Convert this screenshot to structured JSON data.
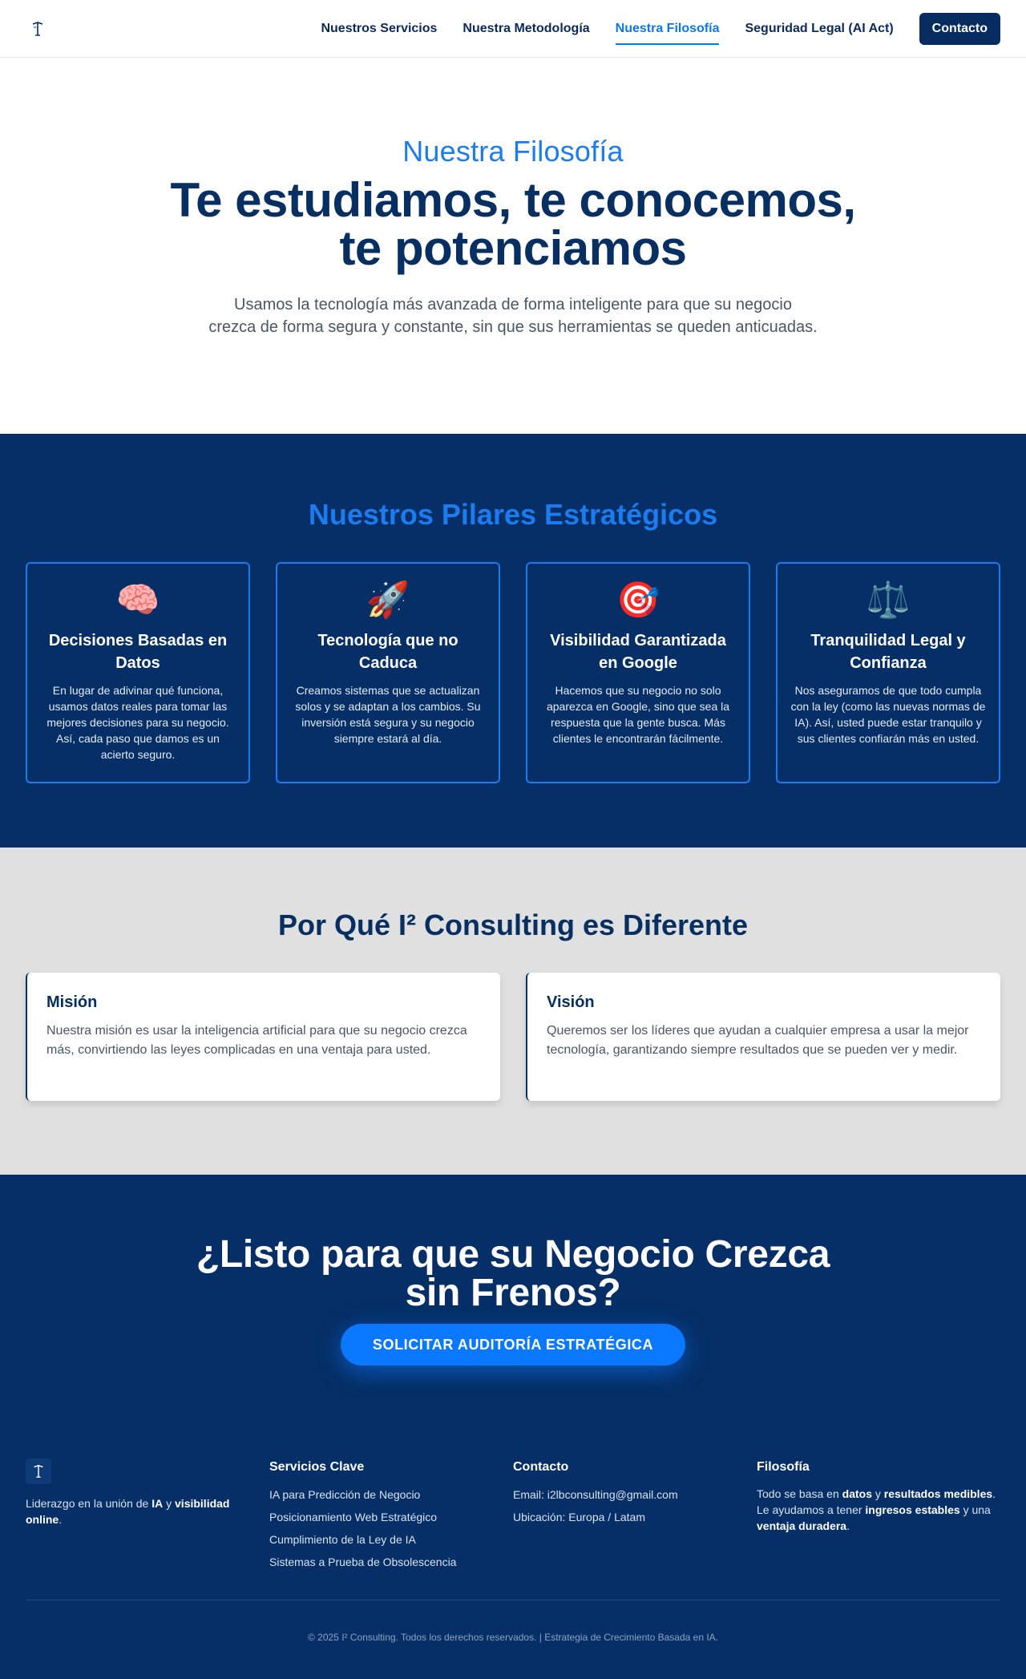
{
  "header": {
    "nav": [
      {
        "label": "Nuestros Servicios"
      },
      {
        "label": "Nuestra Metodología"
      },
      {
        "label": "Nuestra Filosofía"
      },
      {
        "label": "Seguridad Legal (AI Act)"
      }
    ],
    "active_nav": "Nuestra Filosofía",
    "contact_label": "Contacto"
  },
  "hero": {
    "kicker": "Nuestra Filosofía",
    "title_line1": "Te estudiamos, te conocemos,",
    "title_line2": "te potenciamos",
    "subtitle": "Usamos la tecnología más avanzada de forma inteligente para que su negocio crezca de forma segura y constante, sin que sus herramientas se queden anticuadas."
  },
  "pillars": {
    "title": "Nuestros Pilares Estratégicos",
    "items": [
      {
        "icon": "brain-icon",
        "glyph": "🧠",
        "title": "Decisiones Basadas en Datos",
        "text": "En lugar de adivinar qué funciona, usamos datos reales para tomar las mejores decisiones para su negocio. Así, cada paso que damos es un acierto seguro."
      },
      {
        "icon": "rocket-icon",
        "glyph": "🚀",
        "title": "Tecnología que no Caduca",
        "text": "Creamos sistemas que se actualizan solos y se adaptan a los cambios. Su inversión está segura y su negocio siempre estará al día."
      },
      {
        "icon": "target-icon",
        "glyph": "🎯",
        "title": "Visibilidad Garantizada en Google",
        "text": "Hacemos que su negocio no solo aparezca en Google, sino que sea la respuesta que la gente busca. Más clientes le encontrarán fácilmente."
      },
      {
        "icon": "scales-icon",
        "glyph": "⚖️",
        "title": "Tranquilidad Legal y Confianza",
        "text": "Nos aseguramos de que todo cumpla con la ley (como las nuevas normas de IA). Así, usted puede estar tranquilo y sus clientes confiarán más en usted."
      }
    ]
  },
  "why": {
    "title": "Por Qué I² Consulting es Diferente",
    "cards": [
      {
        "title": "Misión",
        "text": "Nuestra misión es usar la inteligencia artificial para que su negocio crezca más, convirtiendo las leyes complicadas en una ventaja para usted."
      },
      {
        "title": "Visión",
        "text": "Queremos ser los líderes que ayudan a cualquier empresa a usar la mejor tecnología, garantizando siempre resultados que se pueden ver y medir."
      }
    ]
  },
  "cta": {
    "title_line1": "¿Listo para que su Negocio Crezca",
    "title_line2": "sin Frenos?",
    "button": "SOLICITAR AUDITORÍA ESTRATÉGICA"
  },
  "footer": {
    "about": {
      "p1": "Liderazgo en la unión de ",
      "b1": "IA",
      "p2": " y ",
      "b2": "visibilidad online",
      "p3": "."
    },
    "services": {
      "title": "Servicios Clave",
      "links": [
        "IA para Predicción de Negocio",
        "Posicionamiento Web Estratégico",
        "Cumplimiento de la Ley de IA",
        "Sistemas a Prueba de Obsolescencia"
      ]
    },
    "contact": {
      "title": "Contacto",
      "email": "Email: i2lbconsulting@gmail.com",
      "location": "Ubicación: Europa / Latam"
    },
    "philosophy": {
      "title": "Filosofía",
      "t1": "Todo se basa en ",
      "b1": "datos",
      "t2": " y ",
      "b2": "resultados medibles",
      "t3": ". Le ayudamos a tener ",
      "b3": "ingresos estables",
      "t4": " y una ",
      "b4": "ventaja duradera",
      "t5": "."
    },
    "copyright": "© 2025 I² Consulting. Todos los derechos reservados. | Estrategia de Crecimiento Basada en IA."
  },
  "colors": {
    "navy": "#052f66",
    "accent": "#1a7cf0",
    "cta_button": "#0a78ff",
    "gray_section": "#e0e0e0"
  }
}
